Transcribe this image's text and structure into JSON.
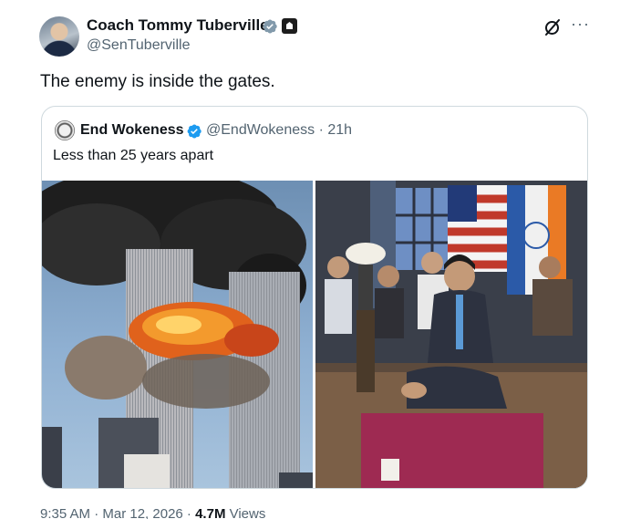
{
  "tweet": {
    "author_name": "Coach Tommy Tuberville",
    "author_handle": "@SenTuberville",
    "text": "The enemy is inside the gates.",
    "timestamp": "9:35 AM · Mar 12, 2026 · ",
    "views_count": "4.7M",
    "views_label": " Views",
    "icons": [
      "verified-badge-icon",
      "government-badge-icon",
      "grok-icon",
      "more-icon"
    ]
  },
  "quote": {
    "author_name": "End Wokeness",
    "author_handle": "@EndWokeness",
    "time": " · 21h",
    "text": "Less than 25 years apart",
    "icons": [
      "verified-badge-icon"
    ]
  },
  "colors": {
    "text_primary": "#0f1419",
    "text_secondary": "#536471",
    "verified_blue": "#1d9bf0",
    "border": "#cfd9de"
  }
}
